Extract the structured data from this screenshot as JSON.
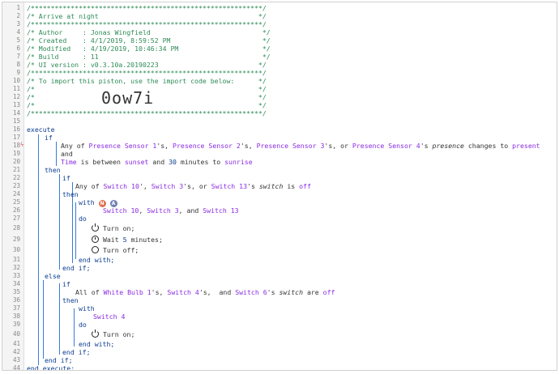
{
  "line_numbers": [
    "1",
    "2",
    "3",
    "4",
    "5",
    "6",
    "7",
    "8",
    "9",
    "10",
    "11",
    "12",
    "13",
    "14",
    "15",
    "16",
    "17",
    "18",
    "19",
    "20",
    "21",
    "22",
    "23",
    "24",
    "25",
    "26",
    "27",
    "28",
    "29",
    "30",
    "31",
    "32",
    "33",
    "34",
    "35",
    "36",
    "37",
    "38",
    "39",
    "40",
    "41",
    "42",
    "43",
    "44"
  ],
  "header": {
    "stars": "/**********************************************************/",
    "title": "/* Arrive at night                                        */",
    "author": "/* Author     : Jonas Wingfield                            */",
    "created": "/* Created    : 4/1/2019, 8:59:52 PM                       */",
    "modified": "/* Modified   : 4/19/2019, 10:46:34 PM                     */",
    "build": "/* Build      : 11                                         */",
    "ui_version": "/* UI version : v0.3.10a.20190223                         */",
    "import_note": "/* To import this piston, use the import code below:      */",
    "blank": "/*                                                        */",
    "import_code_line": "/*                                                        */",
    "import_code": "0ow7i"
  },
  "code": {
    "execute": "execute",
    "if1": "if",
    "cond1_any": "Any of ",
    "ps1": "Presence Sensor 1",
    "ps2": "Presence Sensor 2",
    "ps3": "Presence Sensor 3",
    "ps4": "Presence Sensor 4",
    "possessive": "'s",
    "sep_comma": "', ",
    "sep_s_comma": "'s, ",
    "sep_s_or": "'s, or ",
    "presence": "presence",
    "changes_to": " changes to ",
    "present": "present",
    "and": "and",
    "time": "Time",
    "is_between": " is between ",
    "sunset": "sunset",
    "and_word": " and ",
    "thirty": "30",
    "minutes_to": " minutes to ",
    "sunrise": "sunrise",
    "then": "then",
    "if2": "if",
    "cond2_any": "Any of ",
    "sw10": "Switch 10",
    "sw3": "Switch 3",
    "sw13": "Switch 13",
    "or_word": ", or ",
    "switch_attr": "switch",
    "is_word": " is ",
    "off": "off",
    "then2": "then",
    "with": "with",
    "badge_n": "N",
    "badge_a": "A",
    "with_devices_1": "Switch 10",
    "with_devices_sep": ", ",
    "with_devices_2": "Switch 3",
    "with_devices_and": ", and ",
    "with_devices_3": "Switch 13",
    "do": "do",
    "turn_on": "Turn on;",
    "wait": "Wait ",
    "five": "5",
    "minutes": " minutes;",
    "turn_off": "Turn off;",
    "end_with": "end with;",
    "end_if": "end if;",
    "else": "else",
    "if3": "if",
    "cond3_all": "All of ",
    "wb1": "White Bulb 1",
    "sw4": "Switch 4",
    "sw6": "Switch 6",
    "are_word": " are ",
    "then3": "then",
    "with2": "with",
    "with2_device": "Switch 4",
    "do2": "do",
    "turn_on2": "Turn on;",
    "end_with2": "end with;",
    "end_if2": "end if;",
    "end_if3": "end if;",
    "end_execute": "end execute;"
  },
  "colors": {
    "comment": "#2e8b57",
    "keyword": "#0b3d91",
    "device": "#8a2be2",
    "bar": "#3a7bd5"
  }
}
